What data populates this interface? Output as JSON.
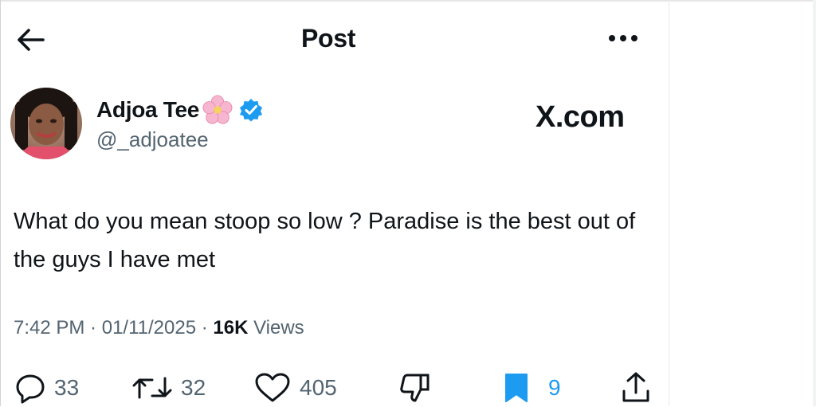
{
  "header": {
    "title": "Post",
    "back_icon": "arrow-left-icon",
    "more_icon": "more-horizontal-icon"
  },
  "author": {
    "name": "Adjoa Tee",
    "name_emoji": "cherry-blossom-icon",
    "verified_icon": "verified-badge-icon",
    "verified_color": "#1d9bf0",
    "handle": "@_adjoatee"
  },
  "watermark": "X.com",
  "tweet": {
    "text": "What do you mean stoop so low ? Paradise is the best out of the guys I have met"
  },
  "meta": {
    "time": "7:42 PM",
    "sep1": " · ",
    "date": "01/11/2025",
    "sep2": " · ",
    "views_count": "16K",
    "views_label": " Views"
  },
  "actions": {
    "replies": "33",
    "reposts": "32",
    "likes": "405",
    "bookmarks": "9",
    "bookmark_color": "#1d9bf0",
    "icons": [
      "reply-icon",
      "repost-icon",
      "like-icon",
      "dislike-icon",
      "bookmark-icon",
      "share-icon"
    ]
  }
}
